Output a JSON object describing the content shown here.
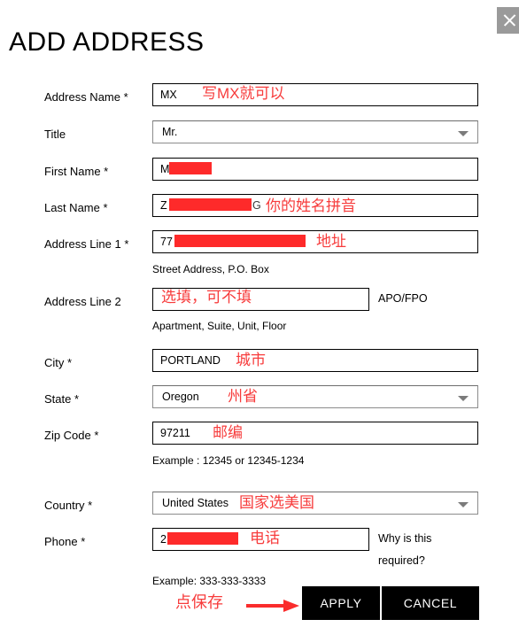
{
  "window": {
    "close_icon": "close-icon"
  },
  "header": {
    "title": "ADD ADDRESS"
  },
  "form": {
    "fields": [
      {
        "key": "address_name",
        "label": "Address Name *",
        "type": "text",
        "value": "MX",
        "annotation": "写MX就可以"
      },
      {
        "key": "title",
        "label": "Title",
        "type": "select",
        "value": "Mr.",
        "annotation": ""
      },
      {
        "key": "first_name",
        "label": "First Name *",
        "type": "text",
        "value": "M",
        "redacted": true,
        "annotation": ""
      },
      {
        "key": "last_name",
        "label": "Last Name *",
        "type": "text",
        "value": "Z",
        "value_tail": "G",
        "redacted": true,
        "annotation": "你的姓名拼音"
      },
      {
        "key": "address_line_1",
        "label": "Address Line 1 *",
        "type": "text",
        "value": "77",
        "redacted": true,
        "annotation": "地址",
        "hint": "Street Address, P.O. Box"
      },
      {
        "key": "address_line_2",
        "label": "Address Line 2",
        "type": "text",
        "value": "",
        "annotation": "选填，可不填",
        "hint": "Apartment, Suite, Unit, Floor",
        "sidenote": "APO/FPO"
      },
      {
        "key": "city",
        "label": "City *",
        "type": "text",
        "value": "PORTLAND",
        "annotation": "城市"
      },
      {
        "key": "state",
        "label": "State *",
        "type": "select",
        "value": "Oregon",
        "annotation": "州省"
      },
      {
        "key": "zip_code",
        "label": "Zip Code *",
        "type": "text",
        "value": "97211",
        "annotation": "邮编",
        "hint": "Example : 12345 or 12345-1234"
      },
      {
        "key": "country",
        "label": "Country *",
        "type": "select",
        "value": "United States",
        "annotation": "国家选美国"
      },
      {
        "key": "phone",
        "label": "Phone *",
        "type": "text",
        "value": "2",
        "redacted": true,
        "annotation": "电话",
        "hint": "Example: 333-333-3333",
        "sidenote": "Why is this required?"
      }
    ]
  },
  "footer": {
    "apply_label": "APPLY",
    "cancel_label": "CANCEL",
    "save_annotation": "点保存"
  },
  "colors": {
    "annotation_red": "#f73c3c",
    "redaction_red": "#fe2a2a",
    "button_black": "#000000",
    "close_gray": "#9a9a9a"
  }
}
